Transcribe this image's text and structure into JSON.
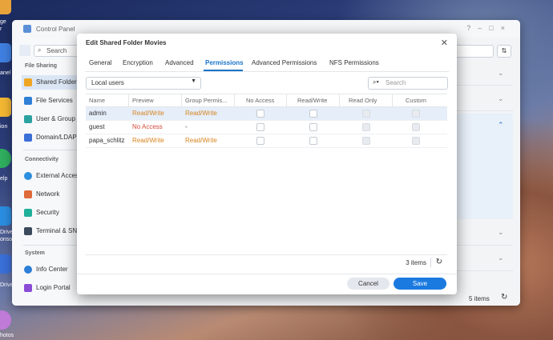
{
  "desktop": {
    "dock_labels": [
      "ge",
      "r",
      "anel",
      "ion",
      "elp",
      "Drive",
      "onsole",
      "Drive",
      "hotos"
    ]
  },
  "control_panel": {
    "title": "Control Panel",
    "search_placeholder": "Search",
    "sections": [
      {
        "header": "File Sharing",
        "items": [
          "Shared Folder",
          "File Services",
          "User & Group",
          "Domain/LDAP"
        ]
      },
      {
        "header": "Connectivity",
        "items": [
          "External Access",
          "Network",
          "Security",
          "Terminal & SNMP"
        ]
      },
      {
        "header": "System",
        "items": [
          "Info Center",
          "Login Portal"
        ]
      }
    ],
    "items_count": "5 items"
  },
  "dialog": {
    "title": "Edit Shared Folder Movies",
    "tabs": [
      "General",
      "Encryption",
      "Advanced",
      "Permissions",
      "Advanced Permissions",
      "NFS Permissions"
    ],
    "active_tab": "Permissions",
    "user_type": "Local users",
    "search_placeholder": "Search",
    "columns": [
      "Name",
      "Preview",
      "Group Permis...",
      "No Access",
      "Read/Write",
      "Read Only",
      "Custom"
    ],
    "rows": [
      {
        "name": "admin",
        "preview": "Read/Write",
        "group": "Read/Write"
      },
      {
        "name": "guest",
        "preview": "No Access",
        "group": "-"
      },
      {
        "name": "papa_schlitz",
        "preview": "Read/Write",
        "group": "Read/Write"
      }
    ],
    "items_count": "3 items",
    "cancel": "Cancel",
    "save": "Save"
  },
  "colors": {
    "accent": "#1a73c9",
    "warning": "#d88420",
    "danger": "#d24a3a"
  }
}
